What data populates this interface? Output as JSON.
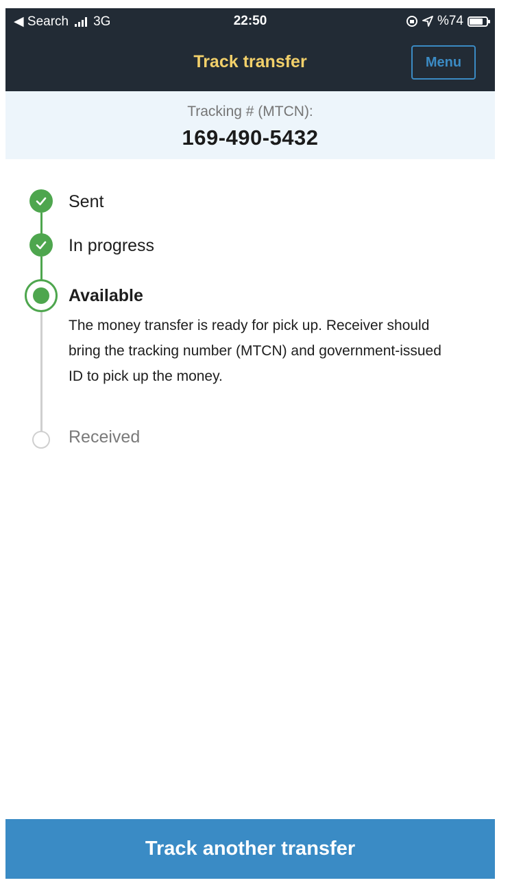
{
  "status_bar": {
    "back_label": "◀ Search",
    "network": "3G",
    "time": "22:50",
    "battery": "%74",
    "battery_level": 0.74
  },
  "nav": {
    "title": "Track transfer",
    "menu_label": "Menu"
  },
  "tracking": {
    "label": "Tracking # (MTCN):",
    "number": "169-490-5432"
  },
  "steps": [
    {
      "label": "Sent",
      "state": "done"
    },
    {
      "label": "In progress",
      "state": "done"
    },
    {
      "label": "Available",
      "state": "current",
      "description": "The money transfer is ready for pick up. Receiver should bring the tracking number (MTCN) and government-issued ID to pick up the money."
    },
    {
      "label": "Received",
      "state": "pending"
    }
  ],
  "footer": {
    "button_label": "Track another transfer"
  },
  "colors": {
    "header_bg": "#222b35",
    "title": "#f2d06a",
    "accent_blue": "#3a8bc5",
    "success_green": "#4ea64e",
    "pending_grey": "#cfcfcf",
    "panel_bg": "#edf5fb"
  },
  "icons": {
    "done": "check-circle-icon",
    "current": "radio-selected-icon",
    "pending": "empty-circle-icon",
    "location": "location-arrow-icon",
    "lock_rotation": "rotation-lock-icon"
  }
}
